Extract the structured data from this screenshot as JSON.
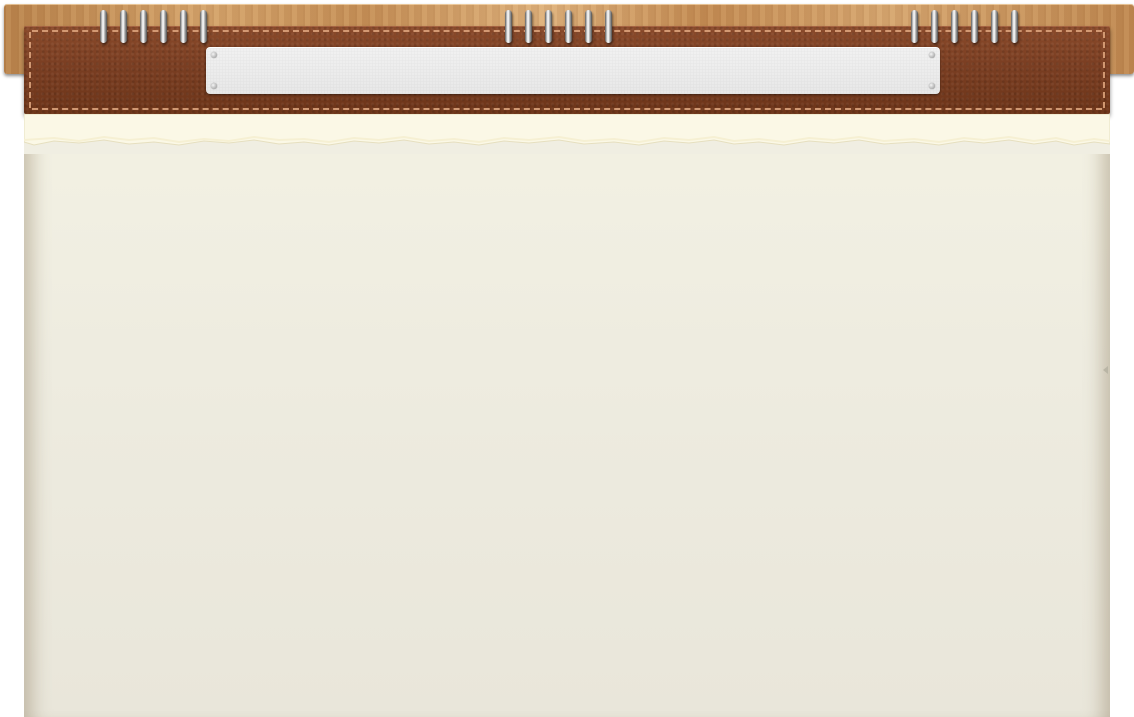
{
  "header": {
    "title": ""
  },
  "binding": {
    "ring_groups": [
      {
        "rings": 6
      },
      {
        "rings": 6
      },
      {
        "rings": 6
      }
    ]
  },
  "colors": {
    "wood": "#c99a63",
    "leather": "#7a3e22",
    "stitching": "#e1a880",
    "title_plate": "#eeeeee",
    "paper": "#f0eee2"
  }
}
